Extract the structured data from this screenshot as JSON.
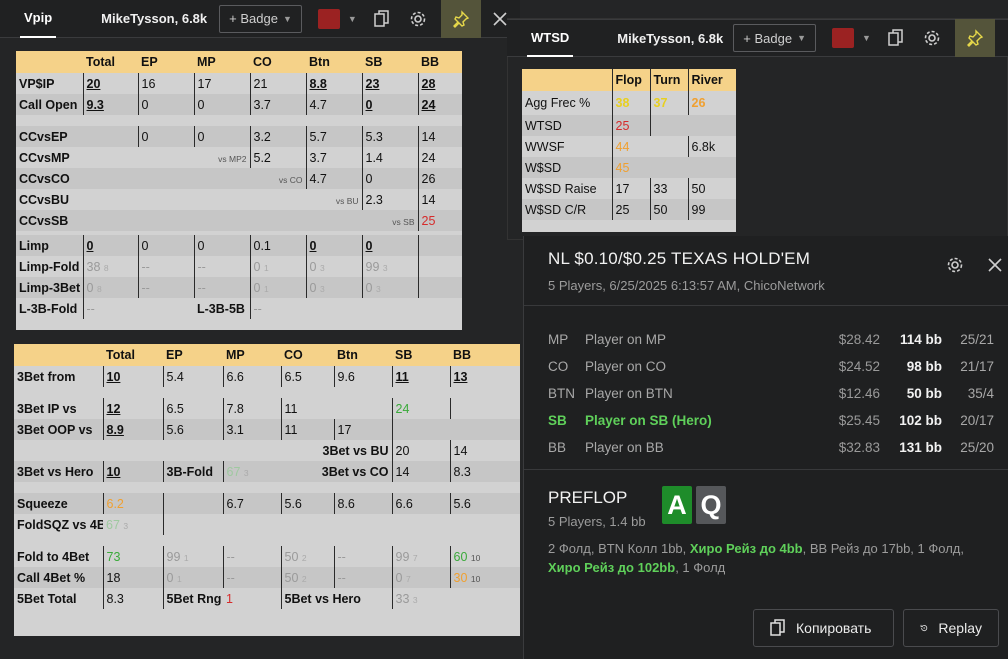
{
  "vpip_panel": {
    "tab": "Vpip",
    "player": "MikeTysson, 6.8k",
    "badge": "+ Badge",
    "swatch_color": "#9b2222",
    "icons": [
      "copy-icon",
      "gear-icon",
      "pin-icon",
      "close-icon"
    ]
  },
  "wtsd_panel": {
    "tab": "WTSD",
    "player": "MikeTysson, 6.8k",
    "badge": "+ Badge",
    "swatch_color": "#9b2222",
    "icons": [
      "copy-icon",
      "gear-icon",
      "pin-icon"
    ]
  },
  "vpip_table": {
    "headers": [
      "Total",
      "EP",
      "MP",
      "CO",
      "Btn",
      "SB",
      "BB"
    ],
    "vpsip": {
      "label": "VP$IP",
      "total": "20",
      "ep": "16",
      "mp": "17",
      "co": "21",
      "btn": "8.8",
      "sb": "23",
      "bb": "28"
    },
    "call_open": {
      "label": "Call Open",
      "total": "9.3",
      "ep": "0",
      "mp": "0",
      "co": "3.7",
      "btn": "4.7",
      "sb": "0",
      "bb": "24"
    },
    "ccvsep": {
      "label": "CCvsEP",
      "ep": "0",
      "mp": "0",
      "co": "3.2",
      "btn": "5.7",
      "sb": "5.3",
      "bb": "14"
    },
    "ccvsmp": {
      "label": "CCvsMP",
      "note": "vs MP2",
      "co": "5.2",
      "btn": "3.7",
      "sb": "1.4",
      "bb": "24"
    },
    "ccvsco": {
      "label": "CCvsCO",
      "note": "vs CO",
      "btn": "4.7",
      "sb": "0",
      "bb": "26"
    },
    "ccvsbu": {
      "label": "CCvsBU",
      "note": "vs BU",
      "sb": "2.3",
      "bb": "14"
    },
    "ccvssb": {
      "label": "CCvsSB",
      "note": "vs SB",
      "bb": "25"
    },
    "limp": {
      "label": "Limp",
      "total": "0",
      "ep": "0",
      "mp": "0",
      "co": "0.1",
      "btn": "0",
      "sb": "0"
    },
    "limp_fold": {
      "label": "Limp-Fold",
      "total": "38",
      "total_n": "8",
      "ep": "--",
      "mp": "--",
      "co": "0",
      "co_n": "1",
      "btn": "0",
      "btn_n": "3",
      "sb": "99",
      "sb_n": "3"
    },
    "limp_3bet": {
      "label": "Limp-3Bet",
      "total": "0",
      "total_n": "8",
      "ep": "--",
      "mp": "--",
      "co": "0",
      "co_n": "1",
      "btn": "0",
      "btn_n": "3",
      "sb": "0",
      "sb_n": "3"
    },
    "l3b_fold": {
      "label": "L-3B-Fold",
      "total": "--",
      "mp_label": "L-3B-5B",
      "co": "--"
    }
  },
  "wtsd_table": {
    "headers": [
      "Flop",
      "Turn",
      "River"
    ],
    "agg": {
      "label": "Agg Frec %",
      "flop": "38",
      "turn": "37",
      "river": "26"
    },
    "wtsd": {
      "label": "WTSD",
      "flop": "25"
    },
    "wwsf": {
      "label": "WWSF",
      "flop": "44",
      "river": "6.8k"
    },
    "wssd": {
      "label": "W$SD",
      "flop": "45"
    },
    "wsd_raise": {
      "label": "W$SD Raise",
      "flop": "17",
      "turn": "33",
      "river": "50"
    },
    "wsd_cr": {
      "label": "W$SD C/R",
      "flop": "25",
      "turn": "50",
      "river": "99"
    }
  },
  "threebet_table": {
    "headers": [
      "Total",
      "EP",
      "MP",
      "CO",
      "Btn",
      "SB",
      "BB"
    ],
    "from": {
      "label": "3Bet from",
      "total": "10",
      "ep": "5.4",
      "mp": "6.6",
      "co": "6.5",
      "btn": "9.6",
      "sb": "11",
      "bb": "13"
    },
    "ip": {
      "label": "3Bet IP vs",
      "total": "12",
      "ep": "6.5",
      "mp": "7.8",
      "co": "11",
      "sb": "24"
    },
    "oop": {
      "label": "3Bet OOP vs",
      "total": "8.9",
      "ep": "5.6",
      "mp": "3.1",
      "co": "11",
      "btn": "17"
    },
    "vs_bu": {
      "label": "3Bet vs BU",
      "sb": "20",
      "bb": "14"
    },
    "vs_hero": {
      "label": "3Bet vs Hero",
      "total": "10",
      "ep_label": "3B-Fold",
      "mp": "67",
      "mp_n": "3",
      "co_label": "3Bet vs CO",
      "sb": "14",
      "bb": "8.3"
    },
    "squeeze": {
      "label": "Squeeze",
      "total": "6.2",
      "mp": "6.7",
      "co": "5.6",
      "btn": "8.6",
      "sb": "6.6",
      "bb": "5.6"
    },
    "foldsqz": {
      "label": "FoldSQZ vs 4B",
      "total": "67",
      "total_n": "3"
    },
    "fold4": {
      "label": "Fold to 4Bet",
      "total": "73",
      "ep": "99",
      "ep_n": "1",
      "mp": "--",
      "co": "50",
      "co_n": "2",
      "btn": "--",
      "sb": "99",
      "sb_n": "7",
      "bb": "60",
      "bb_n": "10"
    },
    "call4": {
      "label": "Call 4Bet %",
      "total": "18",
      "ep": "0",
      "ep_n": "1",
      "mp": "--",
      "co": "50",
      "co_n": "2",
      "btn": "--",
      "sb": "0",
      "sb_n": "7",
      "bb": "30",
      "bb_n": "10"
    },
    "fivebet": {
      "label": "5Bet Total",
      "total": "8.3",
      "ep_label": "5Bet Rng",
      "mp": "1",
      "co_label": "5Bet vs Hero",
      "sb": "33",
      "sb_n": "3"
    }
  },
  "hand": {
    "title": "NL $0.10/$0.25 TEXAS HOLD'EM",
    "subtitle": "5 Players, 6/25/2025 6:13:57 AM, ChicoNetwork",
    "players": [
      {
        "pos": "MP",
        "name": "Player on MP",
        "money": "$28.42",
        "bb": "114 bb",
        "stats": "25/21",
        "hero": false
      },
      {
        "pos": "CO",
        "name": "Player on CO",
        "money": "$24.52",
        "bb": "98 bb",
        "stats": "21/17",
        "hero": false
      },
      {
        "pos": "BTN",
        "name": "Player on BTN",
        "money": "$12.46",
        "bb": "50 bb",
        "stats": "35/4",
        "hero": false
      },
      {
        "pos": "SB",
        "name": "Player on SB (Hero)",
        "money": "$25.45",
        "bb": "102 bb",
        "stats": "20/17",
        "hero": true
      },
      {
        "pos": "BB",
        "name": "Player on BB",
        "money": "$32.83",
        "bb": "131 bb",
        "stats": "25/20",
        "hero": false
      }
    ],
    "street": "PREFLOP",
    "street_sub": "5 Players, 1.4 bb",
    "cards": [
      {
        "rank": "A",
        "color": "#1e8c2a"
      },
      {
        "rank": "Q",
        "color": "#55575a"
      }
    ],
    "actions_1": "2 Фолд, BTN Колл 1bb, ",
    "actions_hero_1": "Хиро Рейз до 4bb",
    "actions_2": ", BB Рейз до 17bb, 1 Фолд,",
    "actions_hero_2": "Хиро Рейз до 102bb",
    "actions_3": ", 1 Фолд",
    "copy_label": "Копировать",
    "replay_label": "Replay"
  }
}
